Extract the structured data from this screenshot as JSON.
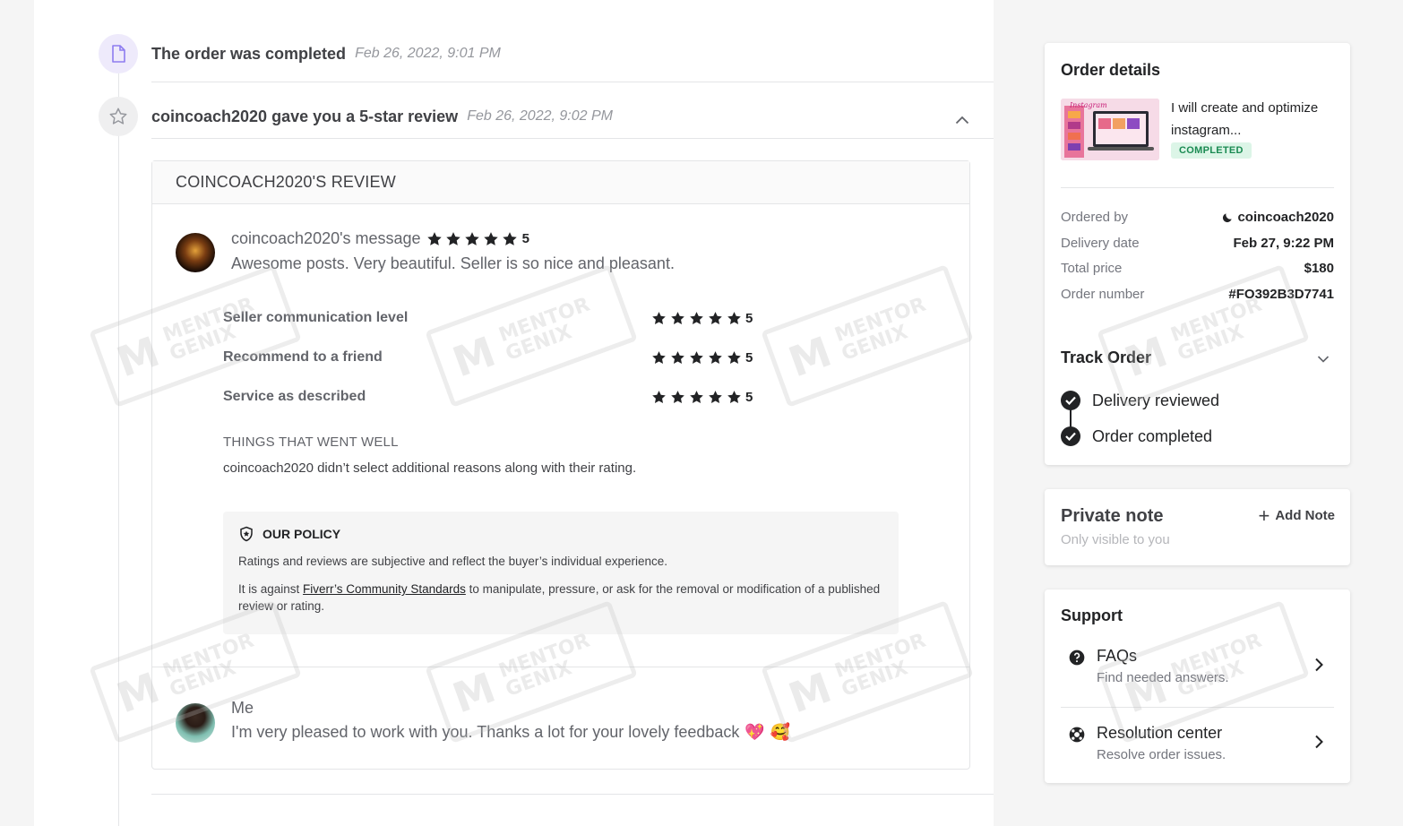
{
  "timeline": {
    "completed": {
      "text": "The order was completed",
      "date": "Feb 26, 2022, 9:01 PM"
    },
    "review_event": {
      "text": "coincoach2020 gave you a 5-star review",
      "date": "Feb 26, 2022, 9:02 PM"
    }
  },
  "review": {
    "header": "COINCOACH2020'S REVIEW",
    "buyer_message_title": "coincoach2020's message",
    "overall_rating": "5",
    "buyer_message": "Awesome posts. Very beautiful. Seller is so nice and pleasant.",
    "ratings": [
      {
        "label": "Seller communication level",
        "value": "5"
      },
      {
        "label": "Recommend to a friend",
        "value": "5"
      },
      {
        "label": "Service as described",
        "value": "5"
      }
    ],
    "went_well_title": "THINGS THAT WENT WELL",
    "went_well_body": "coincoach2020 didn’t select additional reasons along with their rating.",
    "policy": {
      "title": "OUR POLICY",
      "p1": "Ratings and reviews are subjective and reflect the buyer’s individual experience.",
      "p2_before": "It is against ",
      "p2_link": "Fiverr’s Community Standards",
      "p2_after": " to manipulate, pressure, or ask for the removal or modification of a published review or rating."
    },
    "reply": {
      "name": "Me",
      "text": "I'm very pleased to work with you. Thanks a lot for your lovely feedback",
      "emoji1": "💖",
      "emoji2": "🥰"
    }
  },
  "order_details": {
    "title": "Order details",
    "gig_title": "I will create and optimize instagram...",
    "status": "COMPLETED",
    "fields": [
      {
        "key": "Ordered by",
        "value": "coincoach2020"
      },
      {
        "key": "Delivery date",
        "value": "Feb 27, 9:22 PM"
      },
      {
        "key": "Total price",
        "value": "$180"
      },
      {
        "key": "Order number",
        "value": "#FO392B3D7741"
      }
    ],
    "track_title": "Track Order",
    "track_steps": [
      "Delivery reviewed",
      "Order completed"
    ]
  },
  "private_note": {
    "title": "Private note",
    "subtitle": "Only visible to you",
    "add_label": "Add Note"
  },
  "support": {
    "title": "Support",
    "items": [
      {
        "label": "FAQs",
        "desc": "Find needed answers."
      },
      {
        "label": "Resolution center",
        "desc": "Resolve order issues."
      }
    ]
  },
  "watermark": {
    "line1": "MENTOR",
    "line2": "GENIX"
  },
  "colors": {
    "completed_badge_bg": "#dcf5e7",
    "completed_badge_text": "#1a8a52",
    "event_icon_purple": "#8e7cf0"
  }
}
